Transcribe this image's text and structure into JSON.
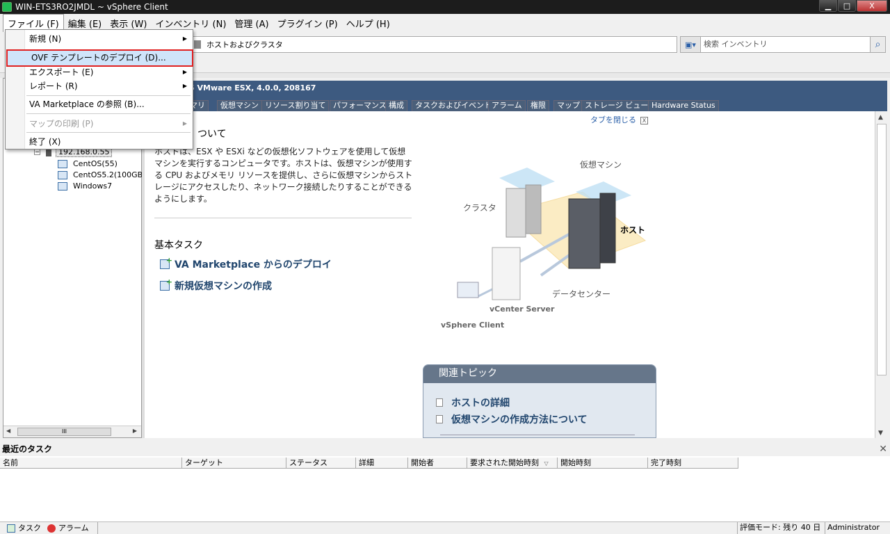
{
  "window": {
    "title": "WIN-ETS3RO2JMDL ~ vSphere Client",
    "min": "▁",
    "max": "□",
    "close": "X"
  },
  "menubar": {
    "file": "ファイル (F)",
    "edit": "編集 (E)",
    "view": "表示 (W)",
    "inventory": "インベントリ (N)",
    "admin": "管理 (A)",
    "plugin": "プラグイン (P)",
    "help": "ヘルプ (H)"
  },
  "file_menu": {
    "new": "新規 (N)",
    "deploy_ovf": "OVF テンプレートのデプロイ (D)...",
    "export": "エクスポート (E)",
    "report": "レポート (R)",
    "va_marketplace": "VA Marketplace の参照 (B)...",
    "print_map": "マップの印刷 (P)",
    "exit": "終了 (X)"
  },
  "toolbar": {
    "breadcrumb": "ホストおよびクラスタ",
    "search_placeholder": "検索 インベントリ"
  },
  "tree": {
    "host": "192.168.0.55",
    "vms": [
      "CentOS(55)",
      "CentOS5.2(100GB)_",
      "Windows7"
    ],
    "hscroll_grip": "III"
  },
  "host_header": "5 VMware ESX, 4.0.0, 208167",
  "tabs": [
    "マリ",
    "仮想マシン",
    "リソース割り当て",
    "パフォーマンス",
    "構成",
    "タスクおよびイベント",
    "アラーム",
    "権限",
    "マップ",
    "ストレージ ビュー",
    "Hardware Status"
  ],
  "close_tab": "タブを閉じる",
  "close_tab_x": "X",
  "summary": {
    "title": "ついて",
    "description": "ホストは、ESX や ESXi などの仮想化ソフトウェアを使用して仮想マシンを実行するコンピュータです。ホストは、仮想マシンが使用する CPU およびメモリ リソースを提供し、さらに仮想マシンからストレージにアクセスしたり、ネットワーク接続したりすることができるようにします。",
    "tasks_title": "基本タスク",
    "task_deploy": "VA Marketplace からのデプロイ",
    "task_create_vm": "新規仮想マシンの作成"
  },
  "diagram": {
    "vm": "仮想マシン",
    "cluster": "クラスタ",
    "host": "ホスト",
    "datacenter": "データセンター",
    "vcenter": "vCenter Server",
    "client": "vSphere Client"
  },
  "related": {
    "title": "関連トピック",
    "link1": "ホストの詳細",
    "link2": "仮想マシンの作成方法について"
  },
  "recent_tasks": {
    "title": "最近のタスク",
    "close": "✕",
    "columns": [
      "名前",
      "ターゲット",
      "ステータス",
      "詳細",
      "開始者",
      "要求された開始時刻",
      "開始時刻",
      "完了時刻"
    ]
  },
  "statusbar": {
    "tasks": "タスク",
    "alarms": "アラーム",
    "eval": "評価モード: 残り 40 日",
    "user": "Administrator"
  },
  "colors": {
    "header_blue": "#3d5a80",
    "link_blue": "#21466e",
    "highlight_red": "#e02020"
  }
}
